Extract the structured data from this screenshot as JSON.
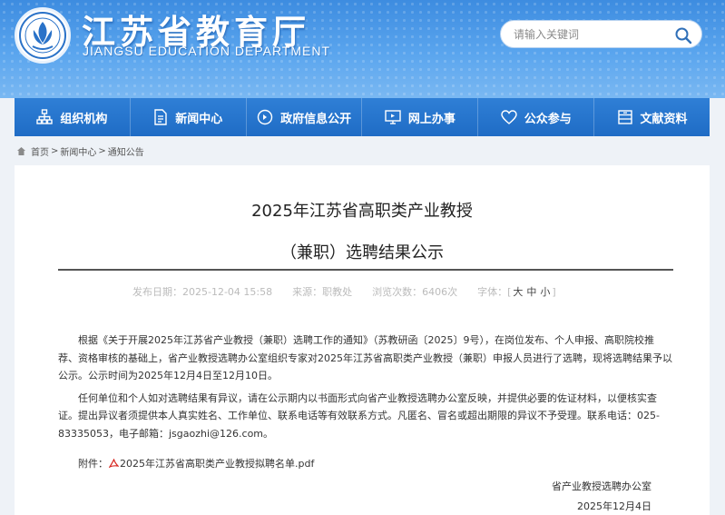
{
  "header": {
    "site_title": "江苏省教育厅",
    "site_subtitle": "JIANGSU EDUCATION DEPARTMENT",
    "search_placeholder": "请输入关键词"
  },
  "nav": {
    "items": [
      {
        "label": "组织机构",
        "icon": "org-chart-icon"
      },
      {
        "label": "新闻中心",
        "icon": "document-icon"
      },
      {
        "label": "政府信息公开",
        "icon": "info-circle-icon"
      },
      {
        "label": "网上办事",
        "icon": "monitor-icon"
      },
      {
        "label": "公众参与",
        "icon": "heart-icon"
      },
      {
        "label": "文献资料",
        "icon": "archive-icon"
      }
    ]
  },
  "breadcrumb": {
    "home": "首页",
    "sep": ">",
    "news": "新闻中心",
    "current": "通知公告"
  },
  "article": {
    "title_line1": "2025年江苏省高职类产业教授",
    "title_line2": "（兼职）选聘结果公示",
    "publish_label": "发布日期：",
    "publish_date": "2025-12-04 15:58",
    "source_label": "来源：",
    "source": "职教处",
    "views_label": "浏览次数：",
    "views": "6406次",
    "font_label": "字体：",
    "font_sizes": [
      "[",
      "大",
      "中",
      "小",
      "]"
    ],
    "paragraph1": "根据《关于开展2025年江苏省产业教授（兼职）选聘工作的通知》（苏教研函〔2025〕9号），在岗位发布、个人申报、高职院校推荐、资格审核的基础上，省产业教授选聘办公室组织专家对2025年江苏省高职类产业教授（兼职）申报人员进行了选聘，现将选聘结果予以公示。公示时间为2025年12月4日至12月10日。",
    "paragraph2": "任何单位和个人如对选聘结果有异议，请在公示期内以书面形式向省产业教授选聘办公室反映，并提供必要的佐证材料，以便核实查证。提出异议者须提供本人真实姓名、工作单位、联系电话等有效联系方式。凡匿名、冒名或超出期限的异议不予受理。联系电话：025-83335053，电子邮箱：jsgaozhi@126.com。",
    "attachment_label": "附件：",
    "attachment_file": "2025年江苏省高职类产业教授拟聘名单.pdf",
    "signature_org": "省产业教授选聘办公室",
    "signature_date": "2025年12月4日"
  },
  "colors": {
    "header_blue": "#4a97e8",
    "nav_blue": "#2575cc",
    "pdf_red": "#d8261f"
  }
}
